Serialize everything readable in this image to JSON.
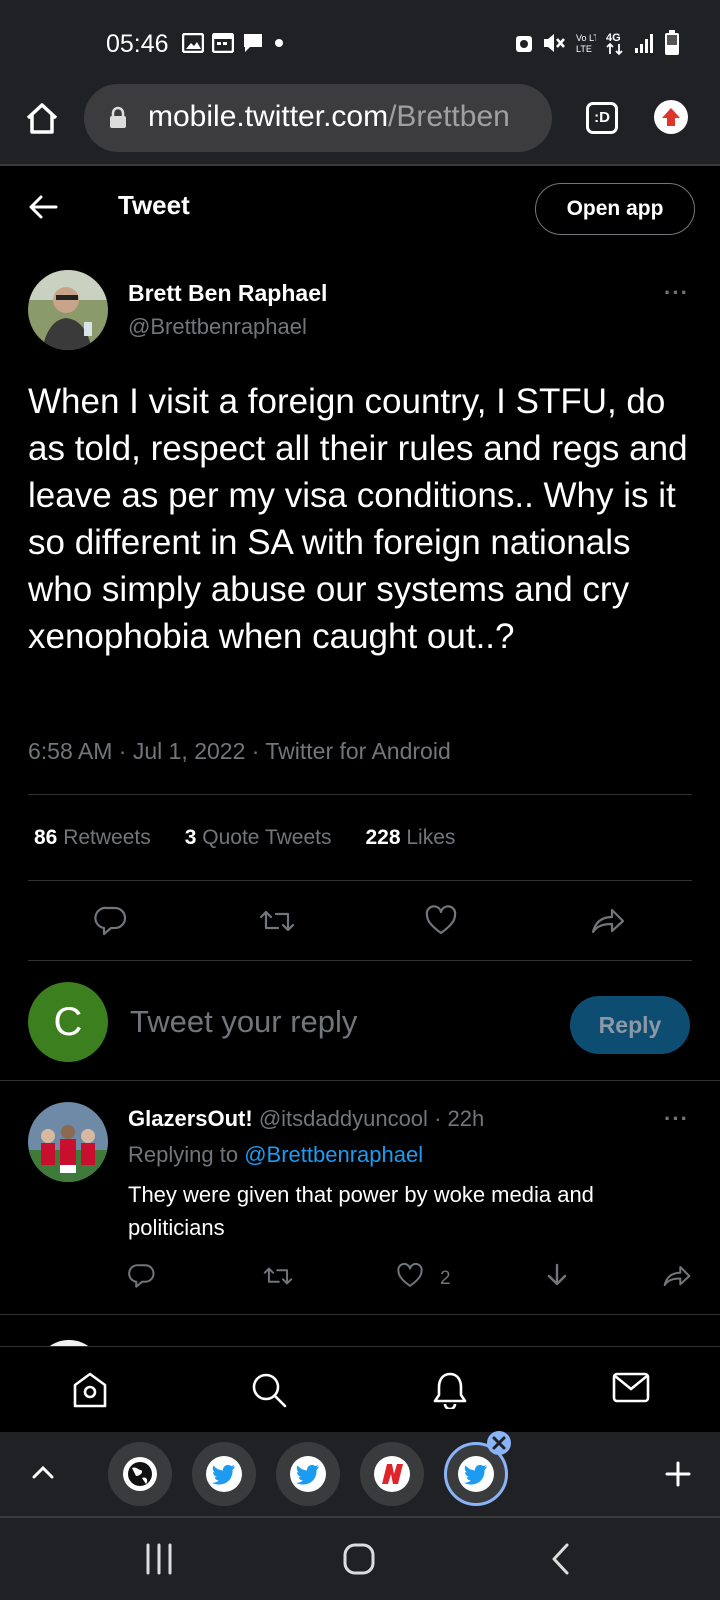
{
  "status_bar": {
    "time": "05:46",
    "left_icons": [
      "image-icon",
      "calendar-icon",
      "chat-icon",
      "dot-icon"
    ],
    "right_icons": [
      "alarm-icon",
      "mute-icon",
      "volte-icon",
      "4g-icon",
      "signal-icon",
      "battery-icon"
    ],
    "volte_label": "Vo LTE",
    "network_label": "4G"
  },
  "browser": {
    "url_host": "mobile.twitter.com",
    "url_path": "/Brettben",
    "tab_icon_label": ":D"
  },
  "header": {
    "title": "Tweet",
    "open_app_label": "Open app"
  },
  "tweet": {
    "author_name": "Brett Ben Raphael",
    "author_handle": "@Brettbenraphael",
    "text": "When I visit a foreign country, I STFU, do as told, respect all their rules and regs and leave as per my visa conditions.. Why is it so different in SA with foreign nationals who simply abuse our systems and cry xenophobia when caught out..?",
    "meta": "6:58 AM · Jul 1, 2022 · Twitter for Android",
    "more_label": "···",
    "stats": {
      "retweets_count": "86",
      "retweets_label": "Retweets",
      "quotes_count": "3",
      "quotes_label": "Quote Tweets",
      "likes_count": "228",
      "likes_label": "Likes"
    }
  },
  "composer": {
    "avatar_letter": "C",
    "placeholder": "Tweet your reply",
    "reply_label": "Reply",
    "avatar_color": "#3c7f1e"
  },
  "reply": {
    "name": "GlazersOut!",
    "handle": "@itsdaddyuncool",
    "time": "· 22h",
    "replying_prefix": "Replying to",
    "replying_to": "@Brettbenraphael",
    "text": "They were given that power by woke media and politicians",
    "likes": "2",
    "more_label": "···"
  },
  "colors": {
    "accent": "#1d9bf0",
    "muted": "#71767b",
    "chrome": "#202124"
  }
}
